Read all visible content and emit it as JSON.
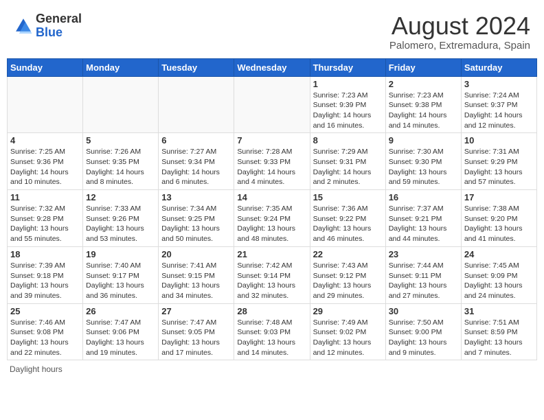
{
  "header": {
    "logo_line1": "General",
    "logo_line2": "Blue",
    "month_year": "August 2024",
    "location": "Palomero, Extremadura, Spain"
  },
  "days_of_week": [
    "Sunday",
    "Monday",
    "Tuesday",
    "Wednesday",
    "Thursday",
    "Friday",
    "Saturday"
  ],
  "weeks": [
    [
      {
        "day": "",
        "info": ""
      },
      {
        "day": "",
        "info": ""
      },
      {
        "day": "",
        "info": ""
      },
      {
        "day": "",
        "info": ""
      },
      {
        "day": "1",
        "info": "Sunrise: 7:23 AM\nSunset: 9:39 PM\nDaylight: 14 hours\nand 16 minutes."
      },
      {
        "day": "2",
        "info": "Sunrise: 7:23 AM\nSunset: 9:38 PM\nDaylight: 14 hours\nand 14 minutes."
      },
      {
        "day": "3",
        "info": "Sunrise: 7:24 AM\nSunset: 9:37 PM\nDaylight: 14 hours\nand 12 minutes."
      }
    ],
    [
      {
        "day": "4",
        "info": "Sunrise: 7:25 AM\nSunset: 9:36 PM\nDaylight: 14 hours\nand 10 minutes."
      },
      {
        "day": "5",
        "info": "Sunrise: 7:26 AM\nSunset: 9:35 PM\nDaylight: 14 hours\nand 8 minutes."
      },
      {
        "day": "6",
        "info": "Sunrise: 7:27 AM\nSunset: 9:34 PM\nDaylight: 14 hours\nand 6 minutes."
      },
      {
        "day": "7",
        "info": "Sunrise: 7:28 AM\nSunset: 9:33 PM\nDaylight: 14 hours\nand 4 minutes."
      },
      {
        "day": "8",
        "info": "Sunrise: 7:29 AM\nSunset: 9:31 PM\nDaylight: 14 hours\nand 2 minutes."
      },
      {
        "day": "9",
        "info": "Sunrise: 7:30 AM\nSunset: 9:30 PM\nDaylight: 13 hours\nand 59 minutes."
      },
      {
        "day": "10",
        "info": "Sunrise: 7:31 AM\nSunset: 9:29 PM\nDaylight: 13 hours\nand 57 minutes."
      }
    ],
    [
      {
        "day": "11",
        "info": "Sunrise: 7:32 AM\nSunset: 9:28 PM\nDaylight: 13 hours\nand 55 minutes."
      },
      {
        "day": "12",
        "info": "Sunrise: 7:33 AM\nSunset: 9:26 PM\nDaylight: 13 hours\nand 53 minutes."
      },
      {
        "day": "13",
        "info": "Sunrise: 7:34 AM\nSunset: 9:25 PM\nDaylight: 13 hours\nand 50 minutes."
      },
      {
        "day": "14",
        "info": "Sunrise: 7:35 AM\nSunset: 9:24 PM\nDaylight: 13 hours\nand 48 minutes."
      },
      {
        "day": "15",
        "info": "Sunrise: 7:36 AM\nSunset: 9:22 PM\nDaylight: 13 hours\nand 46 minutes."
      },
      {
        "day": "16",
        "info": "Sunrise: 7:37 AM\nSunset: 9:21 PM\nDaylight: 13 hours\nand 44 minutes."
      },
      {
        "day": "17",
        "info": "Sunrise: 7:38 AM\nSunset: 9:20 PM\nDaylight: 13 hours\nand 41 minutes."
      }
    ],
    [
      {
        "day": "18",
        "info": "Sunrise: 7:39 AM\nSunset: 9:18 PM\nDaylight: 13 hours\nand 39 minutes."
      },
      {
        "day": "19",
        "info": "Sunrise: 7:40 AM\nSunset: 9:17 PM\nDaylight: 13 hours\nand 36 minutes."
      },
      {
        "day": "20",
        "info": "Sunrise: 7:41 AM\nSunset: 9:15 PM\nDaylight: 13 hours\nand 34 minutes."
      },
      {
        "day": "21",
        "info": "Sunrise: 7:42 AM\nSunset: 9:14 PM\nDaylight: 13 hours\nand 32 minutes."
      },
      {
        "day": "22",
        "info": "Sunrise: 7:43 AM\nSunset: 9:12 PM\nDaylight: 13 hours\nand 29 minutes."
      },
      {
        "day": "23",
        "info": "Sunrise: 7:44 AM\nSunset: 9:11 PM\nDaylight: 13 hours\nand 27 minutes."
      },
      {
        "day": "24",
        "info": "Sunrise: 7:45 AM\nSunset: 9:09 PM\nDaylight: 13 hours\nand 24 minutes."
      }
    ],
    [
      {
        "day": "25",
        "info": "Sunrise: 7:46 AM\nSunset: 9:08 PM\nDaylight: 13 hours\nand 22 minutes."
      },
      {
        "day": "26",
        "info": "Sunrise: 7:47 AM\nSunset: 9:06 PM\nDaylight: 13 hours\nand 19 minutes."
      },
      {
        "day": "27",
        "info": "Sunrise: 7:47 AM\nSunset: 9:05 PM\nDaylight: 13 hours\nand 17 minutes."
      },
      {
        "day": "28",
        "info": "Sunrise: 7:48 AM\nSunset: 9:03 PM\nDaylight: 13 hours\nand 14 minutes."
      },
      {
        "day": "29",
        "info": "Sunrise: 7:49 AM\nSunset: 9:02 PM\nDaylight: 13 hours\nand 12 minutes."
      },
      {
        "day": "30",
        "info": "Sunrise: 7:50 AM\nSunset: 9:00 PM\nDaylight: 13 hours\nand 9 minutes."
      },
      {
        "day": "31",
        "info": "Sunrise: 7:51 AM\nSunset: 8:59 PM\nDaylight: 13 hours\nand 7 minutes."
      }
    ]
  ],
  "footer": {
    "note": "Daylight hours"
  },
  "colors": {
    "header_bg": "#2266cc",
    "header_text": "#ffffff",
    "accent_blue": "#2266cc"
  }
}
